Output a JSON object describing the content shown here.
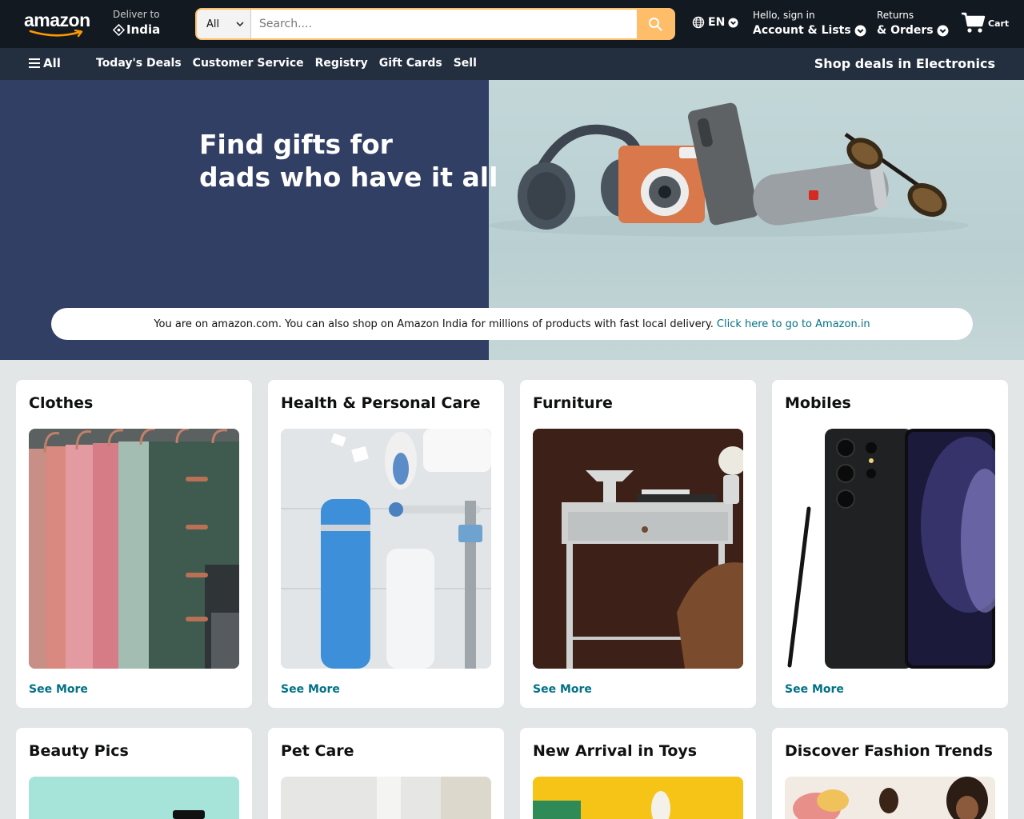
{
  "header": {
    "logo": "amazon",
    "deliver_label": "Deliver to",
    "deliver_value": "India",
    "search_category": "All",
    "search_placeholder": "Search....",
    "language": "EN",
    "account_small": "Hello, sign in",
    "account_big": "Account & Lists",
    "returns_small": "Returns",
    "returns_big": "& Orders",
    "cart_label": "Cart"
  },
  "nav": {
    "all_label": "All",
    "links": [
      "Today's Deals",
      "Customer Service",
      "Registry",
      "Gift Cards",
      "Sell"
    ],
    "deals_label": "Shop deals in Electronics"
  },
  "hero": {
    "title_line1": "Find gifts for",
    "title_line2": "dads who have it all",
    "notice_text": "You are on amazon.com. You can also shop on Amazon India for millions of products with fast local delivery.",
    "notice_link": "Click here to go to Amazon.in"
  },
  "cards": [
    {
      "title": "Clothes",
      "link": "See More"
    },
    {
      "title": "Health & Personal Care",
      "link": "See More"
    },
    {
      "title": "Furniture",
      "link": "See More"
    },
    {
      "title": "Mobiles",
      "link": "See More"
    },
    {
      "title": "Beauty Pics"
    },
    {
      "title": "Pet Care"
    },
    {
      "title": "New Arrival in Toys"
    },
    {
      "title": "Discover Fashion Trends"
    }
  ],
  "colors": {
    "header_bg": "#131921",
    "subnav_bg": "#232f3e",
    "search_accent": "#febd69",
    "link": "#007185",
    "hero_left_bg": "#323f64"
  }
}
